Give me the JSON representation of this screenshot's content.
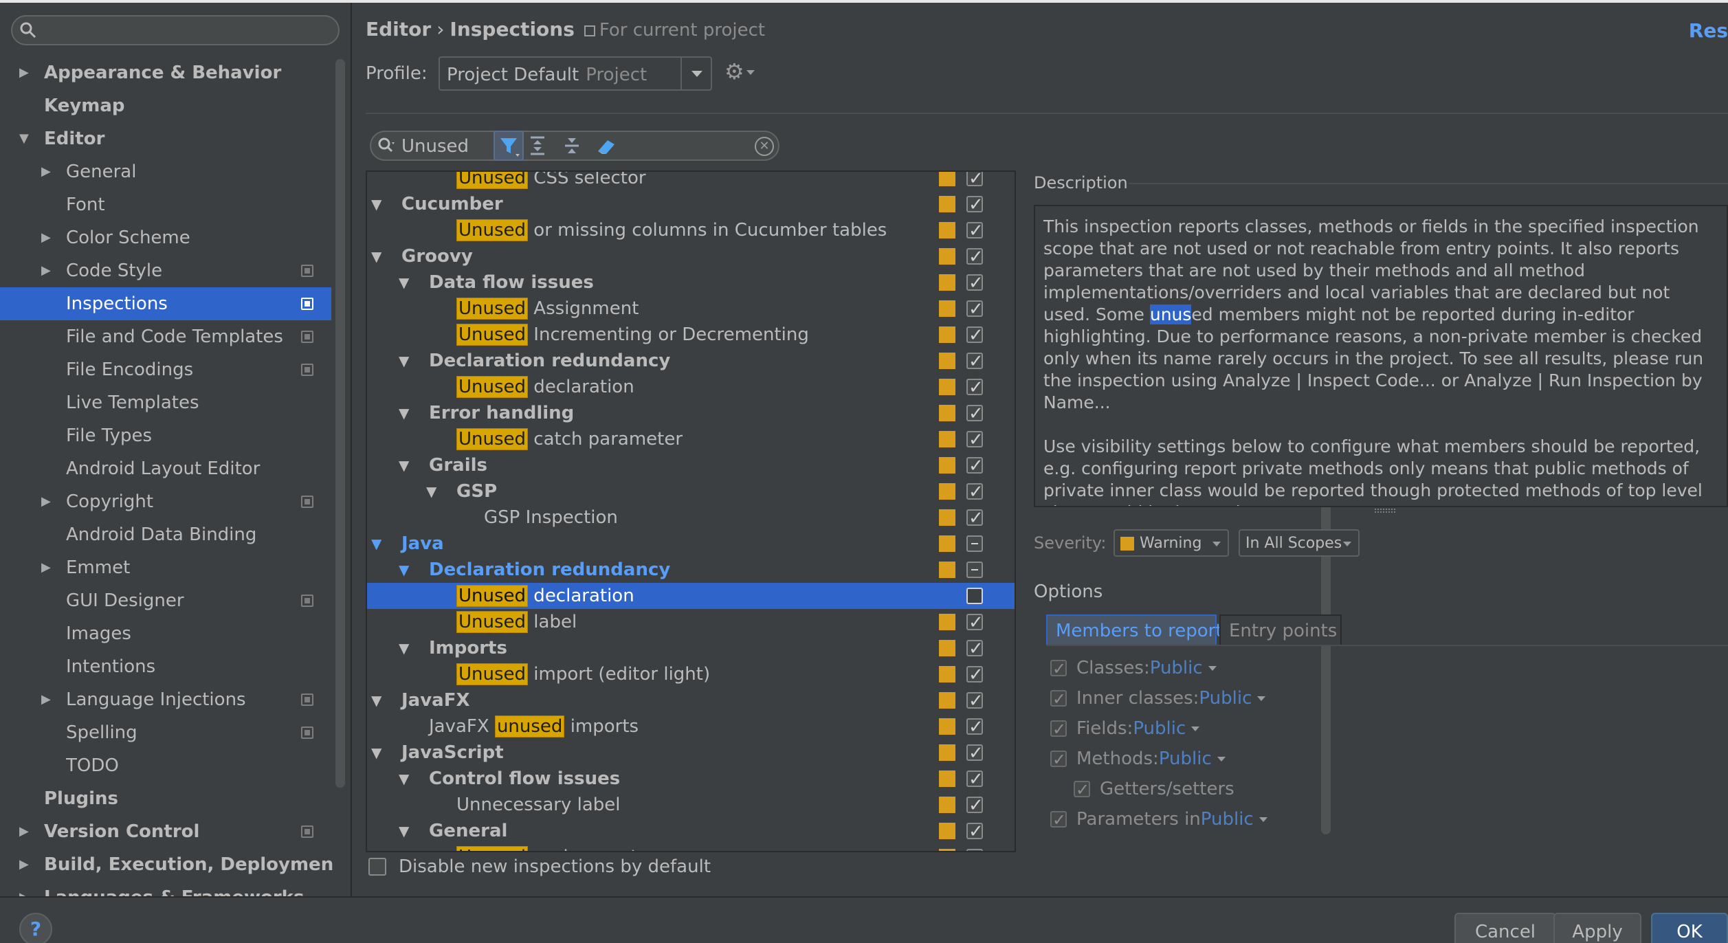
{
  "sidebar": {
    "search": {
      "placeholder": ""
    },
    "items": [
      {
        "label": "Appearance & Behavior",
        "bold": true,
        "arrow": "right",
        "indent": 0,
        "proj": false
      },
      {
        "label": "Keymap",
        "bold": true,
        "arrow": "",
        "indent": 0,
        "proj": false
      },
      {
        "label": "Editor",
        "bold": true,
        "arrow": "down",
        "indent": 0,
        "proj": false
      },
      {
        "label": "General",
        "bold": false,
        "arrow": "right",
        "indent": 1,
        "proj": false
      },
      {
        "label": "Font",
        "bold": false,
        "arrow": "",
        "indent": 1,
        "proj": false
      },
      {
        "label": "Color Scheme",
        "bold": false,
        "arrow": "right",
        "indent": 1,
        "proj": false
      },
      {
        "label": "Code Style",
        "bold": false,
        "arrow": "right",
        "indent": 1,
        "proj": true
      },
      {
        "label": "Inspections",
        "bold": false,
        "arrow": "",
        "indent": 1,
        "proj": true,
        "selected": true
      },
      {
        "label": "File and Code Templates",
        "bold": false,
        "arrow": "",
        "indent": 1,
        "proj": true
      },
      {
        "label": "File Encodings",
        "bold": false,
        "arrow": "",
        "indent": 1,
        "proj": true
      },
      {
        "label": "Live Templates",
        "bold": false,
        "arrow": "",
        "indent": 1,
        "proj": false
      },
      {
        "label": "File Types",
        "bold": false,
        "arrow": "",
        "indent": 1,
        "proj": false
      },
      {
        "label": "Android Layout Editor",
        "bold": false,
        "arrow": "",
        "indent": 1,
        "proj": false
      },
      {
        "label": "Copyright",
        "bold": false,
        "arrow": "right",
        "indent": 1,
        "proj": true
      },
      {
        "label": "Android Data Binding",
        "bold": false,
        "arrow": "",
        "indent": 1,
        "proj": false
      },
      {
        "label": "Emmet",
        "bold": false,
        "arrow": "right",
        "indent": 1,
        "proj": false
      },
      {
        "label": "GUI Designer",
        "bold": false,
        "arrow": "",
        "indent": 1,
        "proj": true
      },
      {
        "label": "Images",
        "bold": false,
        "arrow": "",
        "indent": 1,
        "proj": false
      },
      {
        "label": "Intentions",
        "bold": false,
        "arrow": "",
        "indent": 1,
        "proj": false
      },
      {
        "label": "Language Injections",
        "bold": false,
        "arrow": "right",
        "indent": 1,
        "proj": true
      },
      {
        "label": "Spelling",
        "bold": false,
        "arrow": "",
        "indent": 1,
        "proj": true
      },
      {
        "label": "TODO",
        "bold": false,
        "arrow": "",
        "indent": 1,
        "proj": false
      },
      {
        "label": "Plugins",
        "bold": true,
        "arrow": "",
        "indent": 0,
        "proj": false
      },
      {
        "label": "Version Control",
        "bold": true,
        "arrow": "right",
        "indent": 0,
        "proj": true
      },
      {
        "label": "Build, Execution, Deployment",
        "bold": true,
        "arrow": "right",
        "indent": 0,
        "proj": false
      },
      {
        "label": "Languages & Frameworks",
        "bold": true,
        "arrow": "right",
        "indent": 0,
        "proj": false
      }
    ]
  },
  "header": {
    "crumb_editor": "Editor",
    "crumb_sep": "›",
    "crumb_inspections": "Inspections",
    "scope_note": "For current project",
    "reset": "Res"
  },
  "profile": {
    "label": "Profile:",
    "value": "Project Default",
    "scope": "Project"
  },
  "filter": {
    "value": "Unused",
    "placeholder": ""
  },
  "inspections": [
    {
      "pre": "",
      "hl": "Unused",
      "post": " CSS selector",
      "level": 2,
      "group": false,
      "tri": "",
      "cb": "on"
    },
    {
      "pre": "Cucumber",
      "hl": "",
      "post": "",
      "level": 0,
      "group": true,
      "tri": "down",
      "cb": "on"
    },
    {
      "pre": "",
      "hl": "Unused",
      "post": " or missing columns in Cucumber tables",
      "level": 2,
      "group": false,
      "tri": "",
      "cb": "on"
    },
    {
      "pre": "Groovy",
      "hl": "",
      "post": "",
      "level": 0,
      "group": true,
      "tri": "down",
      "cb": "on"
    },
    {
      "pre": "Data flow issues",
      "hl": "",
      "post": "",
      "level": 1,
      "group": true,
      "tri": "down",
      "cb": "on"
    },
    {
      "pre": "",
      "hl": "Unused",
      "post": " Assignment",
      "level": 2,
      "group": false,
      "tri": "",
      "cb": "on"
    },
    {
      "pre": "",
      "hl": "Unused",
      "post": " Incrementing or Decrementing",
      "level": 2,
      "group": false,
      "tri": "",
      "cb": "on"
    },
    {
      "pre": "Declaration redundancy",
      "hl": "",
      "post": "",
      "level": 1,
      "group": true,
      "tri": "down",
      "cb": "on"
    },
    {
      "pre": "",
      "hl": "Unused",
      "post": " declaration",
      "level": 2,
      "group": false,
      "tri": "",
      "cb": "on"
    },
    {
      "pre": "Error handling",
      "hl": "",
      "post": "",
      "level": 1,
      "group": true,
      "tri": "down",
      "cb": "on"
    },
    {
      "pre": "",
      "hl": "Unused",
      "post": " catch parameter",
      "level": 2,
      "group": false,
      "tri": "",
      "cb": "on"
    },
    {
      "pre": "Grails",
      "hl": "",
      "post": "",
      "level": 1,
      "group": true,
      "tri": "down",
      "cb": "on"
    },
    {
      "pre": "GSP",
      "hl": "",
      "post": "",
      "level": 2,
      "group": true,
      "tri": "down",
      "cb": "on"
    },
    {
      "pre": "GSP Inspection",
      "hl": "",
      "post": "",
      "level": 3,
      "group": false,
      "tri": "",
      "cb": "on"
    },
    {
      "pre": "Java",
      "hl": "",
      "post": "",
      "level": 0,
      "group": true,
      "tri": "down",
      "cb": "mixed",
      "java": true
    },
    {
      "pre": "Declaration redundancy",
      "hl": "",
      "post": "",
      "level": 1,
      "group": true,
      "tri": "down",
      "cb": "mixed",
      "java": true
    },
    {
      "pre": "",
      "hl": "Unused",
      "post": " declaration",
      "level": 2,
      "group": false,
      "tri": "",
      "cb": "off",
      "selected": true
    },
    {
      "pre": "",
      "hl": "Unused",
      "post": " label",
      "level": 2,
      "group": false,
      "tri": "",
      "cb": "on"
    },
    {
      "pre": "Imports",
      "hl": "",
      "post": "",
      "level": 1,
      "group": true,
      "tri": "down",
      "cb": "on"
    },
    {
      "pre": "",
      "hl": "Unused",
      "post": " import (editor light)",
      "level": 2,
      "group": false,
      "tri": "",
      "cb": "on"
    },
    {
      "pre": "JavaFX",
      "hl": "",
      "post": "",
      "level": 0,
      "group": true,
      "tri": "down",
      "cb": "on"
    },
    {
      "pre": "JavaFX ",
      "hl": "unused",
      "post": " imports",
      "level": 1,
      "group": false,
      "tri": "",
      "cb": "on"
    },
    {
      "pre": "JavaScript",
      "hl": "",
      "post": "",
      "level": 0,
      "group": true,
      "tri": "down",
      "cb": "on"
    },
    {
      "pre": "Control flow issues",
      "hl": "",
      "post": "",
      "level": 1,
      "group": true,
      "tri": "down",
      "cb": "on"
    },
    {
      "pre": "Unnecessary label",
      "hl": "",
      "post": "",
      "level": 2,
      "group": false,
      "tri": "",
      "cb": "on"
    },
    {
      "pre": "General",
      "hl": "",
      "post": "",
      "level": 1,
      "group": true,
      "tri": "down",
      "cb": "on"
    },
    {
      "pre": "",
      "hl": "Unused",
      "post": " assignment",
      "level": 2,
      "group": false,
      "tri": "",
      "cb": "on"
    }
  ],
  "disable_new": "Disable new inspections by default",
  "description": {
    "title": "Description",
    "p1_a": "This inspection reports classes, methods or fields in the specified inspection scope that are not used or not reachable from entry points. It also reports parameters that are not used by their methods and all method implementations/overriders and local variables that are declared but not used. Some ",
    "p1_sel": "unus",
    "p1_b": "ed members might not be reported during in-editor highlighting. Due to performance reasons, a non-private member is checked only when its name rarely occurs in the project. To see all results, please run the inspection using Analyze | Inspect Code... or Analyze | Run Inspection by Name...",
    "p2": "Use visibility settings below to configure what members should be reported, e.g. configuring report private methods only means that public methods of private inner class would be reported though protected methods of top level class would be ignored."
  },
  "severity": {
    "label": "Severity:",
    "value": "Warning",
    "scope": "In All Scopes"
  },
  "options": {
    "label": "Options",
    "tabs": [
      "Members to report",
      "Entry points"
    ],
    "rows": [
      {
        "label": "Classes:",
        "link": "Public",
        "indent": 0
      },
      {
        "label": "Inner classes:",
        "link": "Public",
        "indent": 0
      },
      {
        "label": "Fields:",
        "link": "Public",
        "indent": 0
      },
      {
        "label": "Methods:",
        "link": "Public",
        "indent": 0
      },
      {
        "label": "Getters/setters",
        "link": "",
        "indent": 1
      },
      {
        "label": "Parameters in",
        "link": "Public",
        "indent": 0
      }
    ]
  },
  "buttons": {
    "help": "?",
    "cancel": "Cancel",
    "apply": "Apply",
    "ok": "OK"
  }
}
